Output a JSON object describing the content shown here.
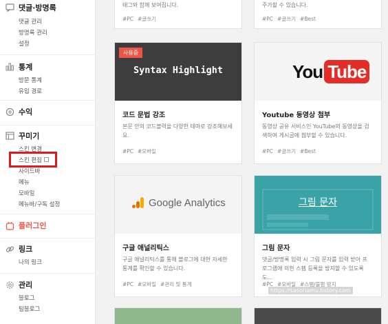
{
  "sidebar": {
    "comments": {
      "title": "댓글·방명록",
      "items": [
        "댓글 관리",
        "방명록 관리",
        "설정"
      ]
    },
    "stats": {
      "title": "통계",
      "items": [
        "방문 통계",
        "유입 경로"
      ]
    },
    "revenue": {
      "title": "수익"
    },
    "decorate": {
      "title": "꾸미기",
      "items": [
        "스킨 변경",
        "스킨 편집",
        "사이드바",
        "메뉴",
        "모바일",
        "메뉴바/구독 설정"
      ]
    },
    "plugin": {
      "title": "플러그인",
      "color": "#ef5547"
    },
    "links": {
      "title": "링크",
      "items": [
        "나의 링크"
      ]
    },
    "manage": {
      "title": "관리",
      "items": [
        "블로그",
        "팀블로그"
      ]
    }
  },
  "cards": {
    "top_left": {
      "desc": "태그와 함께 보여집니다.",
      "tags": [
        "#PC",
        "#글쓰기"
      ]
    },
    "top_right": {
      "desc": "주가할 수 있습니다.",
      "tags": [
        "#PC",
        "#글쓰기",
        "#Best"
      ]
    },
    "syntax": {
      "badge": "사용중",
      "thumb_text": "Syntax Highlight",
      "title": "코드 문법 강조",
      "desc": "본문 안의 코드블럭을 다양한 테마로 강조해보세요.",
      "tags": [
        "#PC",
        "#모바일"
      ]
    },
    "youtube": {
      "logo_you": "You",
      "logo_tube": "Tube",
      "title": "Youtube 동영상 첨부",
      "desc": "동영상 공유 서비스인 YouTube의 동영상을 검색하여 게시글에 첨부할 수 있습니다.",
      "tags": [
        "#PC",
        "#글쓰기",
        "#Best"
      ]
    },
    "ga": {
      "logo_text": "Google Analytics",
      "title": "구글 애널리틱스",
      "desc": "구글 애널리틱스를 통해 블로그에 대한 자세한 통계를 확인할 수 있습니다.",
      "tags": [
        "#PC",
        "#모바일",
        "#관리 및 통계"
      ]
    },
    "image_text": {
      "thumb_text": "그림 문자",
      "title": "그림 문자",
      "desc": "댓글/방명록 입력 시 그림 문자를 입력 받아 프로그램에 의한 스팸 등록을 방지할 수 있도록 도...",
      "tags": [
        "#PC",
        "#모바일",
        "#스팸/불펌 방지"
      ]
    }
  },
  "watermark": "https://sasoriamu.tistory.com",
  "colors": {
    "accent": "#ef5547",
    "teal": "#3aa3a8",
    "dark": "#3d3d3d",
    "highlight": "#e0191d"
  }
}
